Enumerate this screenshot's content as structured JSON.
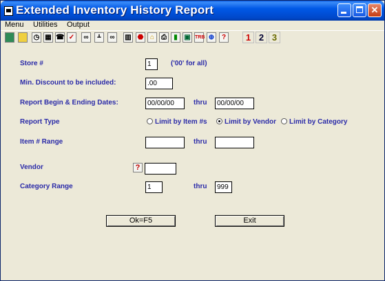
{
  "window": {
    "title": "Extended Inventory History Report"
  },
  "menu": {
    "items": [
      "Menu",
      "Utilities",
      "Output"
    ]
  },
  "toolbar": {
    "icons": [
      "calculator-icon",
      "notepad-icon",
      "clock-icon",
      "calendar-icon",
      "phone-icon",
      "spellcheck-icon",
      "binoculars-icon",
      "org-chart-icon",
      "glasses-icon",
      "barcode-icon",
      "stop-icon",
      "lock-icon",
      "printer-icon",
      "chart-icon",
      "screen-icon",
      "trb-icon",
      "help-circle-icon",
      "question-icon"
    ],
    "numbers": [
      "1",
      "2",
      "3"
    ]
  },
  "form": {
    "store_label": "Store #",
    "store_value": "1",
    "store_hint": "('00' for all)",
    "min_discount_label": "Min. Discount to be included:",
    "min_discount_value": ".00",
    "dates_label": "Report Begin & Ending Dates:",
    "begin_date": "00/00/00",
    "dates_thru": "thru",
    "end_date": "00/00/00",
    "report_type_label": "Report Type",
    "report_type_options": [
      "Limit by Item #s",
      "Limit by Vendor",
      "Limit by Category"
    ],
    "report_type_selected": "Limit by Vendor",
    "item_range_label": "Item # Range",
    "item_from": "",
    "item_thru": "thru",
    "item_to": "",
    "vendor_label": "Vendor",
    "vendor_lookup": "?",
    "vendor_value": "",
    "category_label": "Category Range",
    "category_from": "1",
    "category_thru": "thru",
    "category_to": "999"
  },
  "buttons": {
    "ok": "Ok=F5",
    "exit": "Exit"
  }
}
